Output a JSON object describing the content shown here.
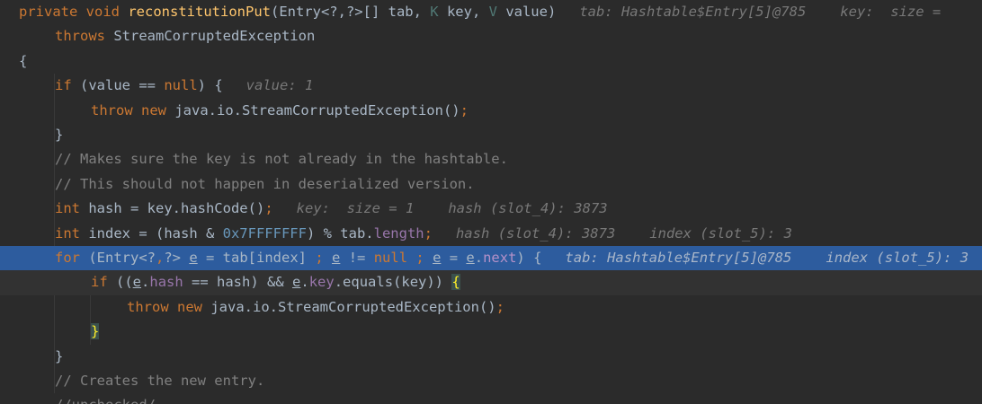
{
  "window": {
    "title": ""
  },
  "editor": {
    "lines": [
      {
        "indent": 0,
        "type": "normal",
        "tokens": [
          {
            "t": "private",
            "c": "kw"
          },
          {
            "t": " "
          },
          {
            "t": "void",
            "c": "kw"
          },
          {
            "t": " "
          },
          {
            "t": "reconstitutionPut",
            "c": "fn"
          },
          {
            "t": "(Entry<?,?>[] tab, "
          },
          {
            "t": "K",
            "c": "tp"
          },
          {
            "t": " key, "
          },
          {
            "t": "V",
            "c": "tp"
          },
          {
            "t": " value)"
          }
        ],
        "hints": [
          "tab: Hashtable$Entry[5]@785",
          "key:  size = "
        ]
      },
      {
        "indent": 1,
        "type": "normal",
        "tokens": [
          {
            "t": "throws",
            "c": "kw"
          },
          {
            "t": " StreamCorruptedException"
          }
        ],
        "hints": []
      },
      {
        "indent": 0,
        "type": "normal",
        "tokens": [
          {
            "t": "{"
          }
        ],
        "hints": []
      },
      {
        "indent": 1,
        "type": "normal",
        "tokens": [
          {
            "t": "if",
            "c": "kw"
          },
          {
            "t": " (value == "
          },
          {
            "t": "null",
            "c": "kw"
          },
          {
            "t": ") {"
          }
        ],
        "hints": [
          "value: 1"
        ]
      },
      {
        "indent": 2,
        "type": "normal",
        "tokens": [
          {
            "t": "throw",
            "c": "kw"
          },
          {
            "t": " "
          },
          {
            "t": "new",
            "c": "kw"
          },
          {
            "t": " java.io.StreamCorruptedException()"
          },
          {
            "t": ";",
            "c": "kw"
          }
        ],
        "hints": []
      },
      {
        "indent": 1,
        "type": "normal",
        "tokens": [
          {
            "t": "}"
          }
        ],
        "hints": []
      },
      {
        "indent": 1,
        "type": "normal",
        "tokens": [
          {
            "t": "// Makes sure the key is not already in the hashtable.",
            "c": "cm"
          }
        ],
        "hints": []
      },
      {
        "indent": 1,
        "type": "normal",
        "tokens": [
          {
            "t": "// This should not happen in deserialized version.",
            "c": "cm"
          }
        ],
        "hints": []
      },
      {
        "indent": 1,
        "type": "normal",
        "tokens": [
          {
            "t": "int",
            "c": "kw"
          },
          {
            "t": " hash = key.hashCode()"
          },
          {
            "t": ";",
            "c": "kw"
          }
        ],
        "hints": [
          "key:  size = 1",
          "hash (slot_4): 3873"
        ]
      },
      {
        "indent": 1,
        "type": "normal",
        "tokens": [
          {
            "t": "int",
            "c": "kw"
          },
          {
            "t": " index = (hash & "
          },
          {
            "t": "0x7FFFFFFF",
            "c": "num"
          },
          {
            "t": ") % tab."
          },
          {
            "t": "length",
            "c": "fld"
          },
          {
            "t": ";",
            "c": "kw"
          }
        ],
        "hints": [
          "hash (slot_4): 3873",
          "index (slot_5): 3"
        ]
      },
      {
        "indent": 1,
        "type": "execution",
        "tokens": [
          {
            "t": "for",
            "c": "kw"
          },
          {
            "t": " (Entry<?"
          },
          {
            "t": ",",
            "c": "kw"
          },
          {
            "t": "?> "
          },
          {
            "t": "e",
            "c": "ul"
          },
          {
            "t": " = tab[index] "
          },
          {
            "t": ";",
            "c": "kw"
          },
          {
            "t": " "
          },
          {
            "t": "e",
            "c": "ul"
          },
          {
            "t": " != "
          },
          {
            "t": "null",
            "c": "kw"
          },
          {
            "t": " "
          },
          {
            "t": ";",
            "c": "kw"
          },
          {
            "t": " "
          },
          {
            "t": "e",
            "c": "ul"
          },
          {
            "t": " = "
          },
          {
            "t": "e",
            "c": "ul"
          },
          {
            "t": "."
          },
          {
            "t": "next",
            "c": "fld"
          },
          {
            "t": ") {"
          }
        ],
        "hints": [
          "tab: Hashtable$Entry[5]@785",
          "index (slot_5): 3"
        ]
      },
      {
        "indent": 2,
        "type": "caret",
        "tokens": [
          {
            "t": "if",
            "c": "kw"
          },
          {
            "t": " (("
          },
          {
            "t": "e",
            "c": "ul"
          },
          {
            "t": "."
          },
          {
            "t": "hash",
            "c": "fld"
          },
          {
            "t": " == hash) && "
          },
          {
            "t": "e",
            "c": "ul"
          },
          {
            "t": "."
          },
          {
            "t": "key",
            "c": "fld"
          },
          {
            "t": ".equals(key)) "
          },
          {
            "t": "{",
            "c": "brace-hl"
          }
        ],
        "hints": []
      },
      {
        "indent": 3,
        "type": "normal",
        "tokens": [
          {
            "t": "throw",
            "c": "kw"
          },
          {
            "t": " "
          },
          {
            "t": "new",
            "c": "kw"
          },
          {
            "t": " java.io.StreamCorruptedException()"
          },
          {
            "t": ";",
            "c": "kw"
          }
        ],
        "hints": []
      },
      {
        "indent": 2,
        "type": "normal",
        "tokens": [
          {
            "t": "}",
            "c": "brace-hl"
          }
        ],
        "hints": []
      },
      {
        "indent": 1,
        "type": "normal",
        "tokens": [
          {
            "t": "}"
          }
        ],
        "hints": []
      },
      {
        "indent": 1,
        "type": "normal",
        "tokens": [
          {
            "t": "// Creates the new entry.",
            "c": "cm"
          }
        ],
        "hints": []
      },
      {
        "indent": 1,
        "type": "normal",
        "tokens": [
          {
            "t": "//unchecked/",
            "c": "cm"
          }
        ],
        "hints": []
      }
    ],
    "colors": {
      "background": "#2b2b2b",
      "execution_line": "#2d5c9e",
      "caret_line": "#323232",
      "keyword": "#cc7832",
      "method": "#ffc66d",
      "comment": "#808080",
      "number": "#6897bb",
      "field": "#9876aa",
      "inline_hint": "#787878"
    }
  }
}
